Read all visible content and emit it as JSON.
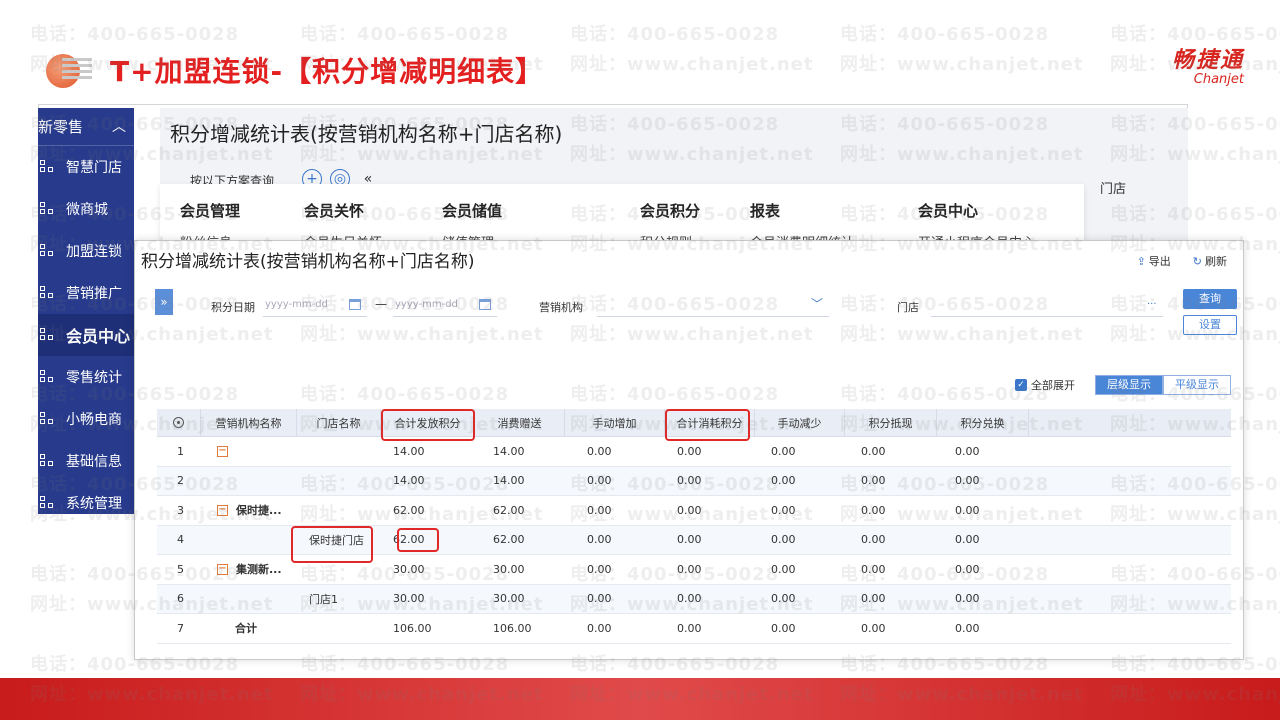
{
  "slide": {
    "title": "T+加盟连锁-【积分增减明细表】",
    "brand_cn": "畅捷通",
    "brand_en": "Chanjet"
  },
  "watermark": {
    "phone": "电话：400-665-0028",
    "site": "网址：www.chanjet.net"
  },
  "sidebar": {
    "header": "新零售",
    "items": [
      {
        "label": "智慧门店"
      },
      {
        "label": "微商城"
      },
      {
        "label": "加盟连锁"
      },
      {
        "label": "营销推广"
      },
      {
        "label": "会员中心",
        "active": true
      },
      {
        "label": "零售统计"
      },
      {
        "label": "小畅电商"
      },
      {
        "label": "基础信息"
      },
      {
        "label": "系统管理"
      }
    ]
  },
  "background_window": {
    "title": "积分增减统计表(按营销机构名称+门店名称)",
    "query_label": "按以下方案查询",
    "store_label": "门店",
    "menu": [
      {
        "label": "会员管理",
        "sub": "粉丝信息"
      },
      {
        "label": "会员关怀",
        "sub": "会员生日关怀"
      },
      {
        "label": "会员储值",
        "sub": "储值管理"
      },
      {
        "label": "会员积分",
        "sub": "积分规则"
      },
      {
        "label": "报表",
        "sub": "会员消费明细统计"
      },
      {
        "label": "会员中心",
        "sub": "开通小程序会员中心"
      }
    ]
  },
  "report": {
    "title": "积分增减统计表(按营销机构名称+门店名称)",
    "export_label": "导出",
    "refresh_label": "刷新",
    "filters": {
      "date_label": "积分日期",
      "date_from_placeholder": "yyyy-mm-dd",
      "date_separator": "—",
      "date_to_placeholder": "yyyy-mm-dd",
      "org_label": "营销机构",
      "store_label": "门店",
      "store_more": "···"
    },
    "query_button": "查询",
    "settings_button": "设置",
    "expand_all_label": "全部展开",
    "view_hierarchical": "层级显示",
    "view_flat": "平级显示",
    "columns": [
      "营销机构名称",
      "门店名称",
      "合计发放积分",
      "消费赠送",
      "手动增加",
      "合计消耗积分",
      "手动减少",
      "积分抵现",
      "积分兑换"
    ],
    "rows": [
      {
        "no": "1",
        "org": "",
        "store": "",
        "issued": "14.00",
        "gift": "14.00",
        "manual_add": "0.00",
        "consumed": "0.00",
        "manual_sub": "0.00",
        "cash": "0.00",
        "exchange": "0.00",
        "toggle": true
      },
      {
        "no": "2",
        "org": "",
        "store": "",
        "issued": "14.00",
        "gift": "14.00",
        "manual_add": "0.00",
        "consumed": "0.00",
        "manual_sub": "0.00",
        "cash": "0.00",
        "exchange": "0.00"
      },
      {
        "no": "3",
        "org": "保时捷...",
        "store": "",
        "issued": "62.00",
        "gift": "62.00",
        "manual_add": "0.00",
        "consumed": "0.00",
        "manual_sub": "0.00",
        "cash": "0.00",
        "exchange": "0.00",
        "toggle": true
      },
      {
        "no": "4",
        "org": "",
        "store": "保时捷门店",
        "issued": "62.00",
        "gift": "62.00",
        "manual_add": "0.00",
        "consumed": "0.00",
        "manual_sub": "0.00",
        "cash": "0.00",
        "exchange": "0.00"
      },
      {
        "no": "5",
        "org": "集测新...",
        "store": "",
        "issued": "30.00",
        "gift": "30.00",
        "manual_add": "0.00",
        "consumed": "0.00",
        "manual_sub": "0.00",
        "cash": "0.00",
        "exchange": "0.00",
        "toggle": true
      },
      {
        "no": "6",
        "org": "",
        "store": "门店1",
        "issued": "30.00",
        "gift": "30.00",
        "manual_add": "0.00",
        "consumed": "0.00",
        "manual_sub": "0.00",
        "cash": "0.00",
        "exchange": "0.00"
      },
      {
        "no": "7",
        "org": "合计",
        "store": "",
        "issued": "106.00",
        "gift": "106.00",
        "manual_add": "0.00",
        "consumed": "0.00",
        "manual_sub": "0.00",
        "cash": "0.00",
        "exchange": "0.00"
      }
    ]
  },
  "colors": {
    "title_red": "#e41f1f",
    "sidebar_blue": "#273a8c",
    "accent_blue": "#4a86d8",
    "highlight_red": "#e02828",
    "band_red": "#c81b1b"
  }
}
